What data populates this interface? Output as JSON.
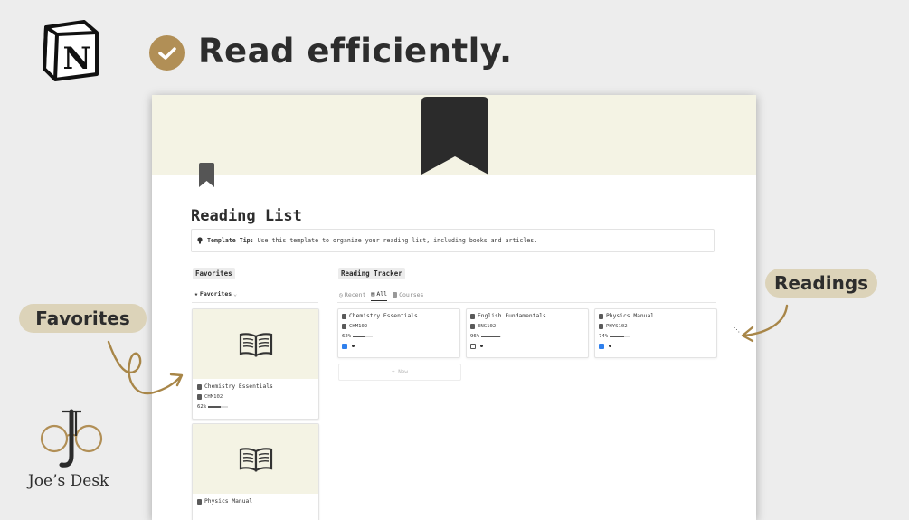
{
  "header": {
    "headline": "Read efficiently."
  },
  "page": {
    "title": "Reading List",
    "tip_label": "Template Tip:",
    "tip_text": "Use this template to organize your reading list, including books and articles."
  },
  "favorites": {
    "section_label": "Favorites",
    "view_label": "Favorites",
    "cards": [
      {
        "title": "Chemistry Essentials",
        "code": "CHM102",
        "progress": "62%",
        "progress_value": 0.62
      },
      {
        "title": "Physics Manual"
      }
    ]
  },
  "tracker": {
    "section_label": "Reading Tracker",
    "tabs": [
      {
        "label": "Recent",
        "icon": "clock-icon",
        "active": false
      },
      {
        "label": "All",
        "icon": "database-icon",
        "active": true
      },
      {
        "label": "Courses",
        "icon": "doc-icon",
        "active": false
      }
    ],
    "cards": [
      {
        "title": "Chemistry Essentials",
        "code": "CHM102",
        "progress": "62%",
        "progress_value": 0.62,
        "done": true
      },
      {
        "title": "English Fundamentals",
        "code": "ENG102",
        "progress": "96%",
        "progress_value": 0.96,
        "done": false
      },
      {
        "title": "Physics Manual",
        "code": "PHYS102",
        "progress": "74%",
        "progress_value": 0.74,
        "done": true
      }
    ],
    "new_label": "+ New"
  },
  "callouts": {
    "favorites": "Favorites",
    "readings": "Readings"
  },
  "brand": {
    "name": "Joe’s Desk"
  },
  "colors": {
    "accent": "#b18f56",
    "pill": "#dcd3b9",
    "cover": "#f4f3e4",
    "checkbox": "#2f80ed"
  }
}
